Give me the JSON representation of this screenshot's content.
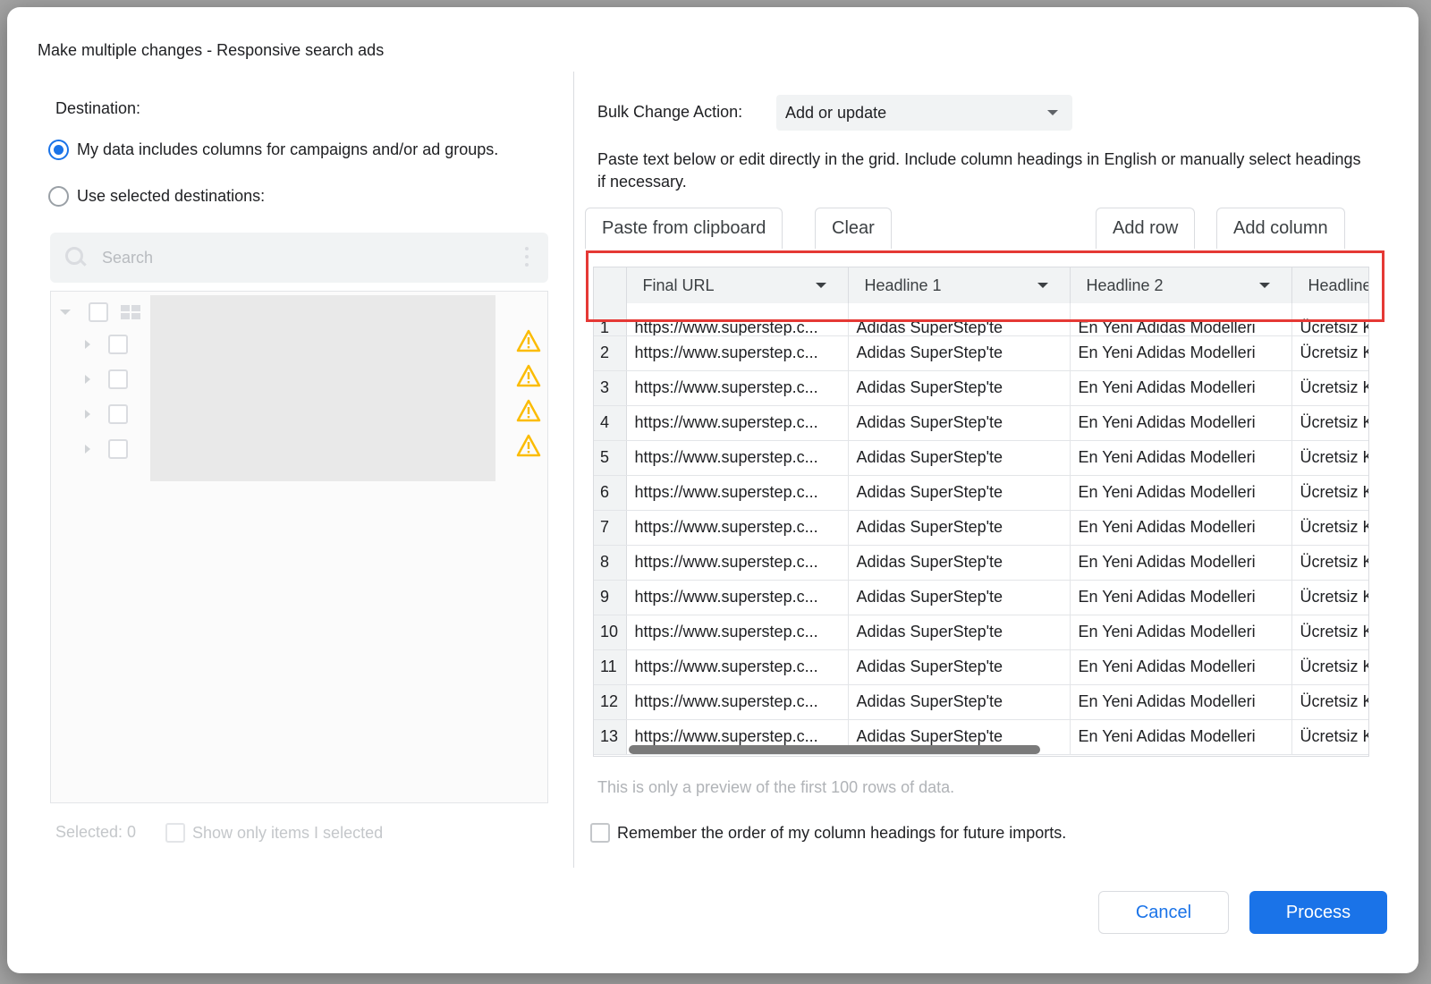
{
  "dialog": {
    "title": "Make multiple changes - Responsive search ads"
  },
  "left": {
    "destination_label": "Destination:",
    "radio_options": [
      {
        "label": "My data includes columns for campaigns and/or ad groups.",
        "selected": true
      },
      {
        "label": "Use selected destinations:",
        "selected": false
      }
    ],
    "search": {
      "placeholder": "Search",
      "icon": "search-icon"
    },
    "selected_count": "Selected: 0",
    "show_only_label": "Show only items I selected"
  },
  "right": {
    "bulk_action_label": "Bulk Change Action:",
    "bulk_action_value": "Add or update",
    "instructions": "Paste text below or edit directly in the grid. Include column headings in English or manually select headings if necessary.",
    "toolbar": {
      "paste_label": "Paste from clipboard",
      "clear_label": "Clear",
      "add_row_label": "Add row",
      "add_column_label": "Add column"
    },
    "grid": {
      "headers": [
        "Final URL",
        "Headline 1",
        "Headline 2",
        "Headline"
      ],
      "rows": [
        {
          "n": "1",
          "url": "https://www.superstep.c...",
          "h1": "Adidas SuperStep'te",
          "h2": "En Yeni Adidas Modelleri",
          "h3": "Ücretsiz K"
        },
        {
          "n": "2",
          "url": "https://www.superstep.c...",
          "h1": "Adidas SuperStep'te",
          "h2": "En Yeni Adidas Modelleri",
          "h3": "Ücretsiz K"
        },
        {
          "n": "3",
          "url": "https://www.superstep.c...",
          "h1": "Adidas SuperStep'te",
          "h2": "En Yeni Adidas Modelleri",
          "h3": "Ücretsiz K"
        },
        {
          "n": "4",
          "url": "https://www.superstep.c...",
          "h1": "Adidas SuperStep'te",
          "h2": "En Yeni Adidas Modelleri",
          "h3": "Ücretsiz K"
        },
        {
          "n": "5",
          "url": "https://www.superstep.c...",
          "h1": "Adidas SuperStep'te",
          "h2": "En Yeni Adidas Modelleri",
          "h3": "Ücretsiz K"
        },
        {
          "n": "6",
          "url": "https://www.superstep.c...",
          "h1": "Adidas SuperStep'te",
          "h2": "En Yeni Adidas Modelleri",
          "h3": "Ücretsiz K"
        },
        {
          "n": "7",
          "url": "https://www.superstep.c...",
          "h1": "Adidas SuperStep'te",
          "h2": "En Yeni Adidas Modelleri",
          "h3": "Ücretsiz K"
        },
        {
          "n": "8",
          "url": "https://www.superstep.c...",
          "h1": "Adidas SuperStep'te",
          "h2": "En Yeni Adidas Modelleri",
          "h3": "Ücretsiz K"
        },
        {
          "n": "9",
          "url": "https://www.superstep.c...",
          "h1": "Adidas SuperStep'te",
          "h2": "En Yeni Adidas Modelleri",
          "h3": "Ücretsiz K"
        },
        {
          "n": "10",
          "url": "https://www.superstep.c...",
          "h1": "Adidas SuperStep'te",
          "h2": "En Yeni Adidas Modelleri",
          "h3": "Ücretsiz K"
        },
        {
          "n": "11",
          "url": "https://www.superstep.c...",
          "h1": "Adidas SuperStep'te",
          "h2": "En Yeni Adidas Modelleri",
          "h3": "Ücretsiz K"
        },
        {
          "n": "12",
          "url": "https://www.superstep.c...",
          "h1": "Adidas SuperStep'te",
          "h2": "En Yeni Adidas Modelleri",
          "h3": "Ücretsiz K"
        },
        {
          "n": "13",
          "url": "https://www.superstep.c...",
          "h1": "Adidas SuperStep'te",
          "h2": "En Yeni Adidas Modelleri",
          "h3": "Ücretsiz K"
        }
      ]
    },
    "preview_note": "This is only a preview of the first 100 rows of data.",
    "remember_label": "Remember the order of my column headings for future imports."
  },
  "footer": {
    "cancel_label": "Cancel",
    "process_label": "Process"
  },
  "colors": {
    "accent": "#1a73e8",
    "highlight": "#e53935",
    "warning": "#fbbc04"
  }
}
